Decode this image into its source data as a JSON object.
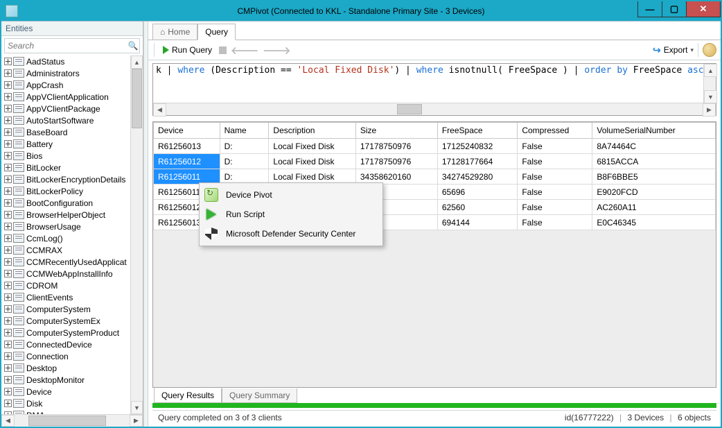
{
  "window": {
    "title": "CMPivot (Connected to KKL - Standalone Primary Site - 3 Devices)"
  },
  "entities_panel": {
    "header": "Entities",
    "search_placeholder": "Search",
    "items": [
      "AadStatus",
      "Administrators",
      "AppCrash",
      "AppVClientApplication",
      "AppVClientPackage",
      "AutoStartSoftware",
      "BaseBoard",
      "Battery",
      "Bios",
      "BitLocker",
      "BitLockerEncryptionDetails",
      "BitLockerPolicy",
      "BootConfiguration",
      "BrowserHelperObject",
      "BrowserUsage",
      "CcmLog()",
      "CCMRAX",
      "CCMRecentlyUsedApplicat",
      "CCMWebAppInstallInfo",
      "CDROM",
      "ClientEvents",
      "ComputerSystem",
      "ComputerSystemEx",
      "ComputerSystemProduct",
      "ConnectedDevice",
      "Connection",
      "Desktop",
      "DesktopMonitor",
      "Device",
      "Disk",
      "DMA"
    ]
  },
  "tabs": {
    "home": "Home",
    "query": "Query"
  },
  "toolbar": {
    "run": "Run Query",
    "export": "Export"
  },
  "query_text_parts": {
    "p1": "k | ",
    "kw1": "where",
    "p2": " (Description == ",
    "str1": "'Local Fixed Disk'",
    "p3": ") | ",
    "kw2": "where",
    "p4": " isnotnull( FreeSpace ) | ",
    "kw3": "order by",
    "p5": " FreeSpace ",
    "kw4": "asc"
  },
  "grid": {
    "columns": [
      "Device",
      "Name",
      "Description",
      "Size",
      "FreeSpace",
      "Compressed",
      "VolumeSerialNumber"
    ],
    "rows": [
      {
        "sel": false,
        "cells": [
          "R61256013",
          "D:",
          "Local Fixed Disk",
          "17178750976",
          "17125240832",
          "False",
          "8A74464C"
        ]
      },
      {
        "sel": true,
        "cells": [
          "R61256012",
          "D:",
          "Local Fixed Disk",
          "17178750976",
          "17128177664",
          "False",
          "6815ACCA"
        ]
      },
      {
        "sel": true,
        "cells": [
          "R61256011",
          "D:",
          "Local Fixed Disk",
          "34358620160",
          "34274529280",
          "False",
          "B8F6BBE5"
        ]
      },
      {
        "sel": false,
        "cells": [
          "R61256011",
          "",
          "",
          "",
          "65696",
          "False",
          "E9020FCD"
        ]
      },
      {
        "sel": false,
        "cells": [
          "R61256012",
          "",
          "",
          "",
          "62560",
          "False",
          "AC260A11"
        ]
      },
      {
        "sel": false,
        "cells": [
          "R61256013",
          "",
          "",
          "",
          "694144",
          "False",
          "E0C46345"
        ]
      }
    ]
  },
  "context_menu": {
    "items": [
      "Device Pivot",
      "Run Script",
      "Microsoft Defender Security Center"
    ]
  },
  "bottom_tabs": {
    "results": "Query Results",
    "summary": "Query Summary"
  },
  "status": {
    "left": "Query completed on 3 of 3 clients",
    "id": "id(16777222)",
    "devices": "3 Devices",
    "objects": "6 objects"
  }
}
